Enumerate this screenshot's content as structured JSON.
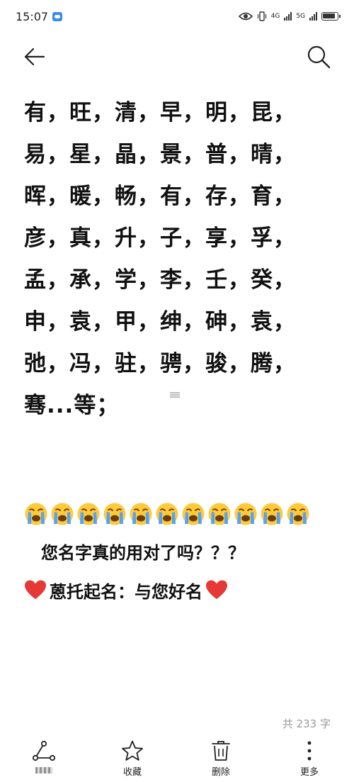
{
  "status_bar": {
    "time": "15:07",
    "net_4g": "4G",
    "net_5g": "5G"
  },
  "note": {
    "lines": [
      "有，旺，清，早，明，昆，",
      "易，星，晶，景，普，晴，",
      "晖，暖，畅，有，存，育，",
      "彦，真，升，子，享，孚，",
      "孟，承，学，李，壬，癸，",
      "申，袁，甲，绅，砷，袁，",
      "弛，冯，驻，骋，骏，腾，",
      "骞...等；"
    ],
    "emoji_count": 11,
    "question": "您名字真的用对了吗？？？",
    "brand": "蒽托起名：与您好名",
    "word_count": "共 233 字"
  },
  "bottom_bar": {
    "share_label": "",
    "favorite_label": "收藏",
    "delete_label": "删除",
    "more_label": "更多"
  },
  "colors": {
    "heart": "#e53935",
    "emoji_face": "#ffc93c",
    "tears": "#4fa3ff",
    "word_count": "#9a9a9a"
  }
}
